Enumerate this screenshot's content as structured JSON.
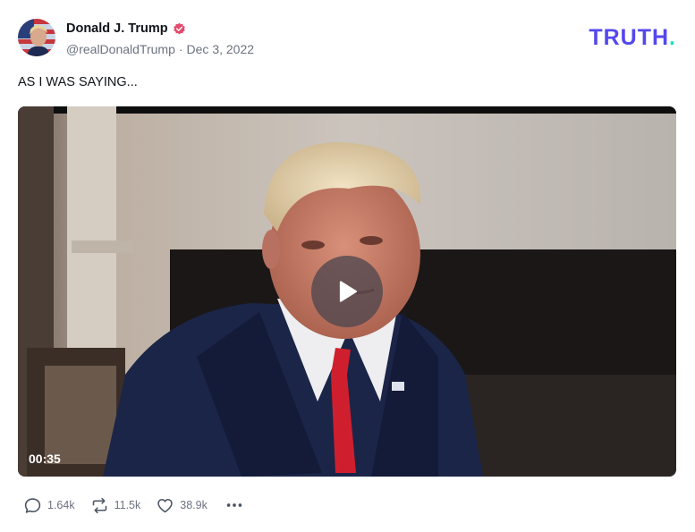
{
  "author": {
    "name": "Donald J. Trump",
    "handle": "@realDonaldTrump",
    "separator": "·",
    "date": "Dec 3, 2022"
  },
  "brand": {
    "logo_text": "TRUTH",
    "logo_dot": ".",
    "color": "#5448ee",
    "dot_color": "#17e1c5"
  },
  "post": {
    "text": "AS I WAS SAYING..."
  },
  "video": {
    "duration": "00:35",
    "play_icon": "play-icon"
  },
  "actions": {
    "replies": "1.64k",
    "retruths": "11.5k",
    "likes": "38.9k",
    "icons": [
      "reply-icon",
      "retruth-icon",
      "heart-icon",
      "more-icon"
    ]
  },
  "colors": {
    "verified": "#e24a6e",
    "muted_text": "#6b7280"
  }
}
